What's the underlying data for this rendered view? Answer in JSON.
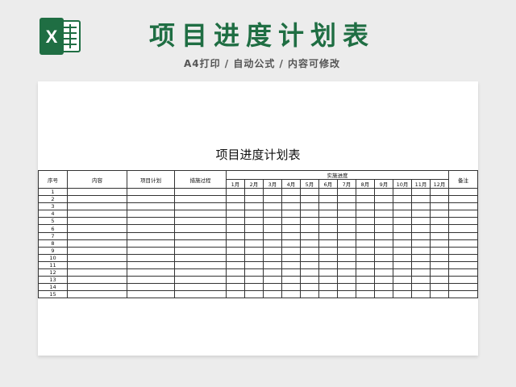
{
  "header": {
    "title": "项目进度计划表",
    "subtitle": "A4打印 / 自动公式 / 内容可修改"
  },
  "brand": {
    "logo_letter": "X",
    "color": "#1f6e43"
  },
  "sheet": {
    "title": "项目进度计划表",
    "columns": {
      "seq": "序号",
      "content": "内容",
      "plan": "项目计划",
      "process": "措施过程",
      "progress": "实施进度",
      "remarks": "备注"
    },
    "months": [
      "1月",
      "2月",
      "3月",
      "4月",
      "5月",
      "6月",
      "7月",
      "8月",
      "9月",
      "10月",
      "11月",
      "12月"
    ],
    "rows": [
      "1",
      "2",
      "3",
      "4",
      "5",
      "6",
      "7",
      "8",
      "9",
      "10",
      "11",
      "12",
      "13",
      "14",
      "15"
    ]
  }
}
